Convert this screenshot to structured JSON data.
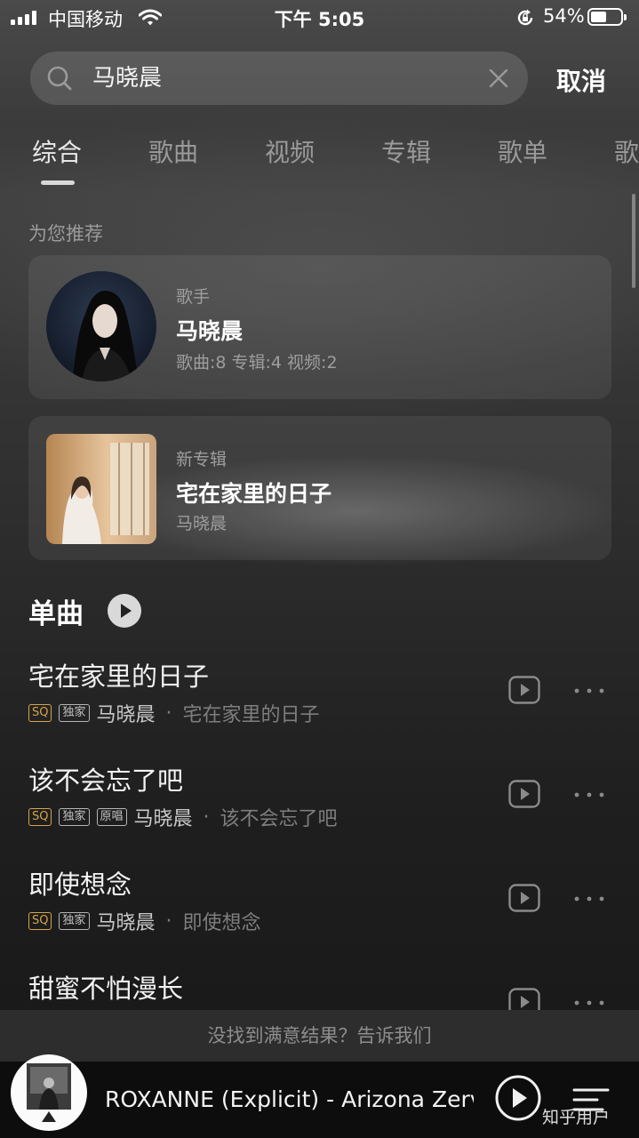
{
  "status_bar": {
    "carrier": "中国移动",
    "time": "下午 5:05",
    "battery_percent": "54%",
    "battery_level": 0.54
  },
  "search": {
    "query": "马晓晨",
    "cancel_label": "取消"
  },
  "tabs": [
    {
      "label": "综合",
      "active": true
    },
    {
      "label": "歌曲",
      "active": false
    },
    {
      "label": "视频",
      "active": false
    },
    {
      "label": "专辑",
      "active": false
    },
    {
      "label": "歌单",
      "active": false
    },
    {
      "label": "歌",
      "active": false
    }
  ],
  "recommend": {
    "section_label": "为您推荐",
    "artist_card": {
      "type": "歌手",
      "name": "马晓晨",
      "stats": "歌曲:8 专辑:4 视频:2"
    },
    "album_card": {
      "type": "新专辑",
      "title": "宅在家里的日子",
      "artist": "马晓晨"
    }
  },
  "singles": {
    "title": "单曲",
    "songs": [
      {
        "title": "宅在家里的日子",
        "badges": [
          "SQ",
          "独家"
        ],
        "artist": "马晓晨",
        "album": "宅在家里的日子"
      },
      {
        "title": "该不会忘了吧",
        "badges": [
          "SQ",
          "独家",
          "原唱"
        ],
        "artist": "马晓晨",
        "album": "该不会忘了吧"
      },
      {
        "title": "即使想念",
        "badges": [
          "SQ",
          "独家"
        ],
        "artist": "马晓晨",
        "album": "即使想念"
      },
      {
        "title": "甜蜜不怕漫长",
        "badges": [],
        "artist": "",
        "album": ""
      }
    ]
  },
  "feedback": {
    "text": "没找到满意结果？告诉我们"
  },
  "player": {
    "now_playing": "ROXANNE (Explicit) - Arizona Zervas"
  },
  "watermark": "知乎用户",
  "icons": {
    "search": "search-icon",
    "clear": "clear-icon",
    "play": "play-icon",
    "more": "more-icon",
    "playlist": "playlist-icon"
  },
  "colors": {
    "sq_badge": "#d7a44a",
    "background_top": "#4a4a4a",
    "background_bottom": "#1a1a1a"
  }
}
